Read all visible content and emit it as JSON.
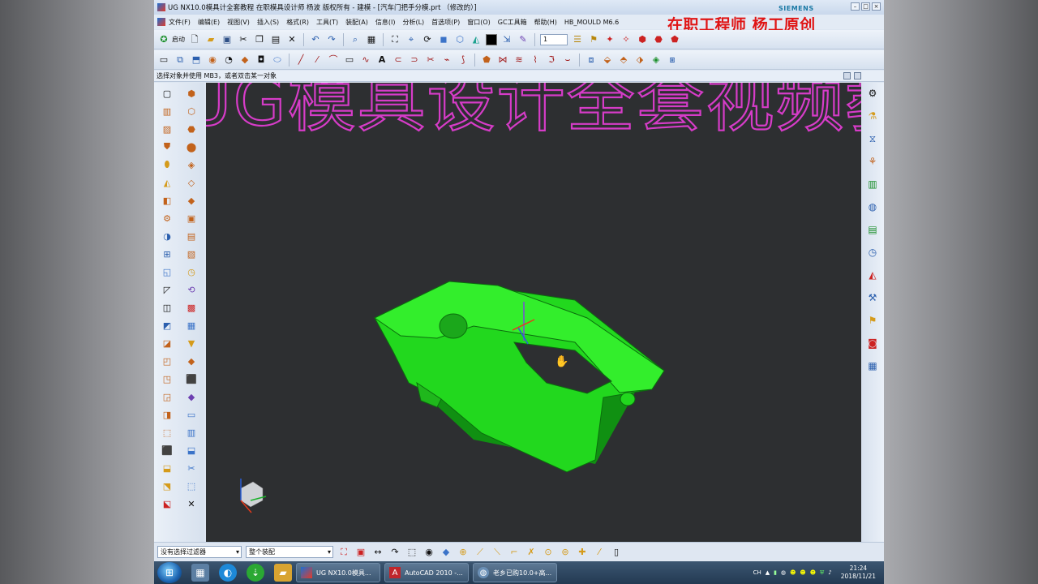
{
  "window": {
    "title": "UG NX10.0模具计全套教程 在职模具设计师 杨波 版权所有 - 建模 - [汽车门把手分模.prt （修改的）]",
    "brand": "SIEMENS",
    "watermark": "在职工程师  杨工原创"
  },
  "menu": [
    "文件(F)",
    "编辑(E)",
    "视图(V)",
    "插入(S)",
    "格式(R)",
    "工具(T)",
    "装配(A)",
    "信息(I)",
    "分析(L)",
    "首选项(P)",
    "窗口(O)",
    "GC工具箱",
    "帮助(H)",
    "HB_MOULD M6.6"
  ],
  "toolbar": {
    "start_label": "启动",
    "layer_value": "1",
    "color_swatch": "#000000"
  },
  "cue_line": "选择对象并使用 MB3，或者双击某一对象",
  "viewport": {
    "background": "#2d2f31",
    "model_color": "#22d81e",
    "banner_text": "UG模具设计全套视频教",
    "banner_color": "#d63cc8"
  },
  "statusbar": {
    "filter_value": "没有选择过滤器",
    "scope_value": "整个装配"
  },
  "taskbar": {
    "tasks": [
      "UG NX10.0模具...",
      "AutoCAD 2010 -...",
      "老乡已购10.0+高..."
    ],
    "tray_lang": "CH",
    "time": "21:24",
    "date": "2018/11/21"
  }
}
